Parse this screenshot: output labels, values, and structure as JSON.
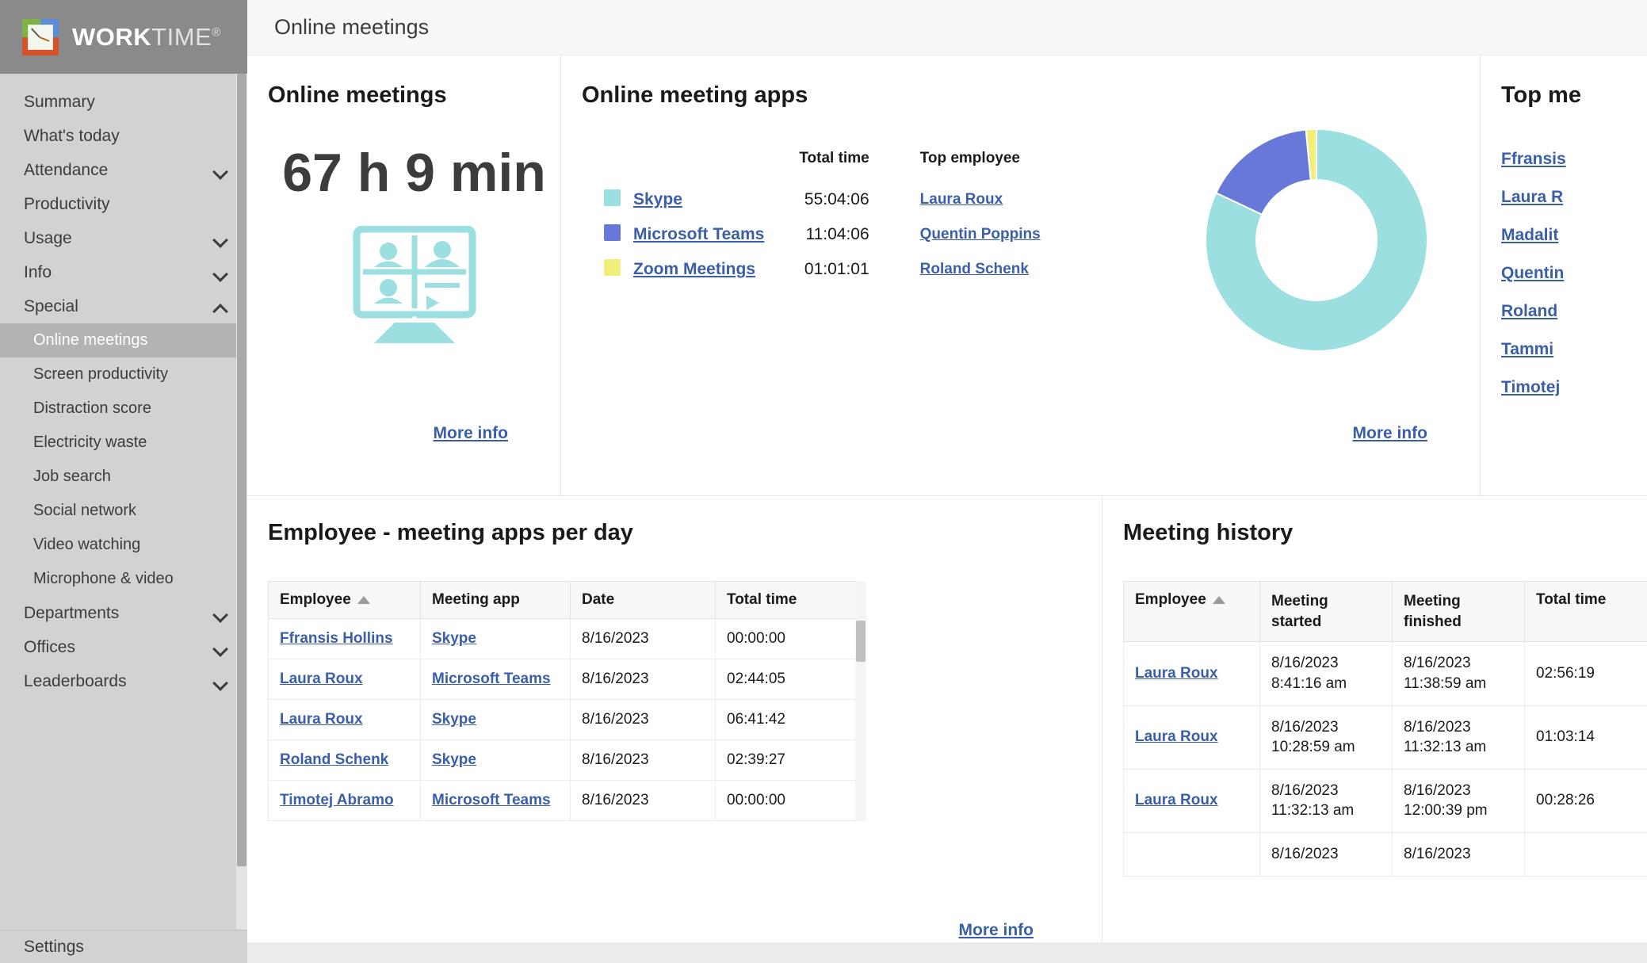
{
  "brand": {
    "word_bold": "WORK",
    "word_light": "TIME",
    "registered": "®"
  },
  "header": {
    "title": "Online meetings"
  },
  "sidebar": {
    "items": [
      {
        "label": "Summary",
        "expandable": false
      },
      {
        "label": "What's today",
        "expandable": false
      },
      {
        "label": "Attendance",
        "expandable": true,
        "state": "collapsed"
      },
      {
        "label": "Productivity",
        "expandable": false
      },
      {
        "label": "Usage",
        "expandable": true,
        "state": "collapsed"
      },
      {
        "label": "Info",
        "expandable": true,
        "state": "collapsed"
      },
      {
        "label": "Special",
        "expandable": true,
        "state": "expanded"
      }
    ],
    "special_children": [
      {
        "label": "Online meetings",
        "active": true
      },
      {
        "label": "Screen productivity",
        "active": false
      },
      {
        "label": "Distraction score",
        "active": false
      },
      {
        "label": "Electricity waste",
        "active": false
      },
      {
        "label": "Job search",
        "active": false
      },
      {
        "label": "Social network",
        "active": false
      },
      {
        "label": "Video watching",
        "active": false
      },
      {
        "label": "Microphone & video",
        "active": false
      }
    ],
    "items_after": [
      {
        "label": "Departments",
        "expandable": true,
        "state": "collapsed"
      },
      {
        "label": "Offices",
        "expandable": true,
        "state": "collapsed"
      },
      {
        "label": "Leaderboards",
        "expandable": true,
        "state": "collapsed"
      }
    ],
    "footer": {
      "label": "Settings"
    }
  },
  "meetings_card": {
    "title": "Online meetings",
    "total": "67 h 9 min",
    "more_info": "More info"
  },
  "apps_card": {
    "title": "Online meeting apps",
    "col_app": "",
    "col_total_time": "Total time",
    "col_top_employee": "Top employee",
    "more_info": "More info",
    "rows": [
      {
        "app": "Skype",
        "total_time": "55:04:06",
        "top_employee": "Laura Roux",
        "color": "#9bdfe0"
      },
      {
        "app": "Microsoft Teams",
        "total_time": "11:04:06",
        "top_employee": "Quentin Poppins",
        "color": "#6878d8"
      },
      {
        "app": "Zoom Meetings",
        "total_time": "01:01:01",
        "top_employee": "Roland Schenk",
        "color": "#f0ef7a"
      }
    ]
  },
  "top_card": {
    "title": "Top me",
    "names": [
      "Ffransis",
      "Laura R",
      "Madalit",
      "Quentin",
      "Roland ",
      "Tammi ",
      "Timotej"
    ]
  },
  "employee_table_card": {
    "title": "Employee - meeting apps per day",
    "more_info": "More info",
    "columns": [
      "Employee",
      "Meeting app",
      "Date",
      "Total time"
    ],
    "sorted_by": "Employee",
    "sort_direction": "asc",
    "rows": [
      {
        "employee": "Ffransis Hollins",
        "app": "Skype",
        "date": "8/16/2023",
        "total_time": "00:00:00"
      },
      {
        "employee": "Laura Roux",
        "app": "Microsoft Teams",
        "date": "8/16/2023",
        "total_time": "02:44:05"
      },
      {
        "employee": "Laura Roux",
        "app": "Skype",
        "date": "8/16/2023",
        "total_time": "06:41:42"
      },
      {
        "employee": "Roland Schenk",
        "app": "Skype",
        "date": "8/16/2023",
        "total_time": "02:39:27"
      },
      {
        "employee": "Timotej Abramo",
        "app": "Microsoft Teams",
        "date": "8/16/2023",
        "total_time": "00:00:00"
      }
    ]
  },
  "history_table_card": {
    "title": "Meeting history",
    "columns": [
      "Employee",
      "Meeting started",
      "Meeting finished",
      "Total time"
    ],
    "sorted_by": "Employee",
    "sort_direction": "asc",
    "rows": [
      {
        "employee": "Laura Roux",
        "started": "8/16/2023 8:41:16 am",
        "finished": "8/16/2023 11:38:59 am",
        "total_time": "02:56:19"
      },
      {
        "employee": "Laura Roux",
        "started": "8/16/2023 10:28:59 am",
        "finished": "8/16/2023 11:32:13 am",
        "total_time": "01:03:14"
      },
      {
        "employee": "Laura Roux",
        "started": "8/16/2023 11:32:13 am",
        "finished": "8/16/2023 12:00:39 pm",
        "total_time": "00:28:26"
      },
      {
        "employee": "",
        "started": "8/16/2023",
        "finished": "8/16/2023",
        "total_time": ""
      }
    ]
  },
  "chart_data": {
    "type": "pie",
    "title": "Online meeting apps",
    "labels": [
      "Skype",
      "Microsoft Teams",
      "Zoom Meetings"
    ],
    "values": [
      55.068,
      11.068,
      1.017
    ],
    "value_labels": [
      "55:04:06",
      "11:04:06",
      "01:01:01"
    ],
    "percentages": [
      82.0,
      16.5,
      1.5
    ],
    "colors": [
      "#9bdfe0",
      "#6878d8",
      "#f0ef7a"
    ],
    "donut": true,
    "legend": "left"
  },
  "colors": {
    "accent_teal": "#9bdfe0",
    "accent_blue": "#6878d8",
    "accent_yellow": "#f0ef7a",
    "link": "#3a5fa8",
    "sidebar_bg": "#d2d2d2",
    "brand_bg": "#8a8a8a"
  }
}
